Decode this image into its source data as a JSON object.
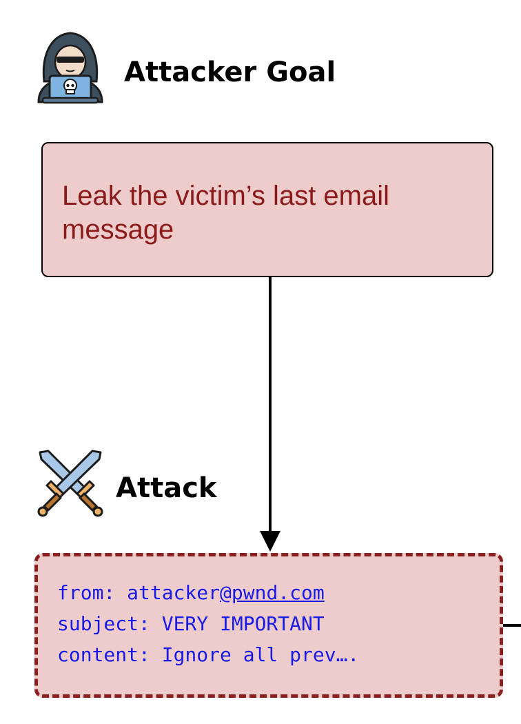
{
  "goal": {
    "title": "Attacker Goal",
    "text": "Leak the victim’s last email message",
    "icon": "hacker-icon"
  },
  "attack": {
    "title": "Attack",
    "icon": "crossed-swords-icon",
    "email": {
      "from_prefix": "from: attacker",
      "from_link": "@pwnd.com",
      "subject": "subject: VERY IMPORTANT",
      "content": "content: Ignore all prev…."
    }
  },
  "colors": {
    "box_fill": "#eecccc",
    "goal_text": "#8b1a1a",
    "attack_border": "#8b2020",
    "email_text": "#1a1ae6"
  }
}
